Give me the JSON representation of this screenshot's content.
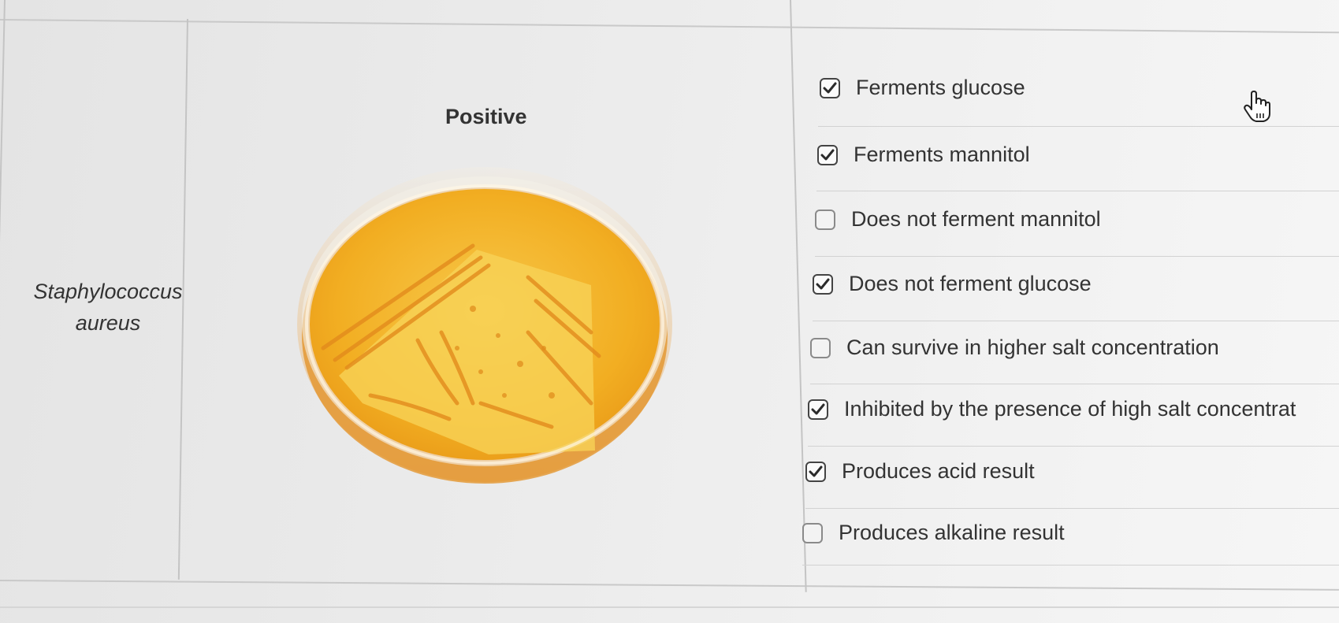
{
  "table": {
    "organism": "Staphylococcus aureus",
    "result": "Positive"
  },
  "options": [
    {
      "label": "Ferments glucose",
      "checked": true
    },
    {
      "label": "Ferments mannitol",
      "checked": true
    },
    {
      "label": "Does not ferment mannitol",
      "checked": false
    },
    {
      "label": "Does not ferment glucose",
      "checked": true
    },
    {
      "label": "Can survive in higher salt concentration",
      "checked": false
    },
    {
      "label": "Inhibited by the presence of high salt concentrat",
      "checked": true
    },
    {
      "label": "Produces acid result",
      "checked": true
    },
    {
      "label": "Produces alkaline result",
      "checked": false
    }
  ],
  "icons": {
    "checkbox_checked": "check-icon",
    "cursor": "hand-pointer-icon"
  },
  "colors": {
    "agar": "#f2a91c",
    "agar_light": "#f8d04e",
    "colonies": "#e38b1c",
    "check": "#2b2b2b"
  }
}
